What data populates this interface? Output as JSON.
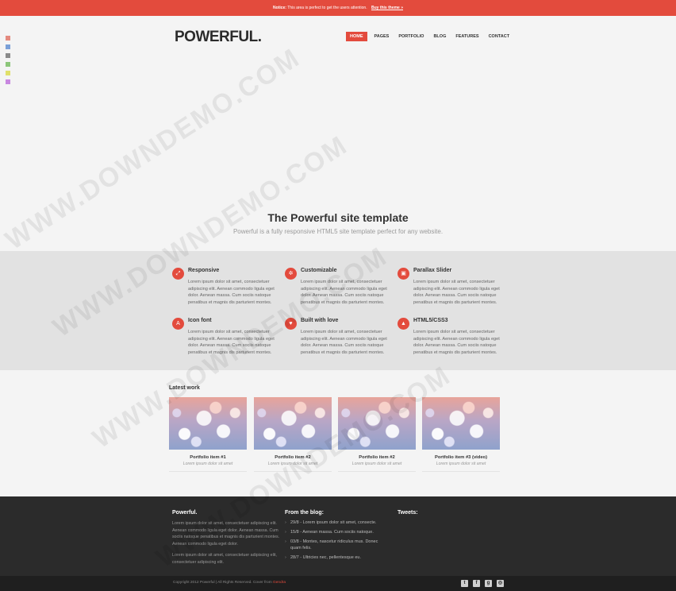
{
  "notice": {
    "label": "Notice:",
    "text": "This area is perfect to get the users attention.",
    "cta": "Buy this theme »"
  },
  "swatches": [
    "#e48a7f",
    "#7aa0d8",
    "#8a8a8a",
    "#8cc67a",
    "#e0e06a",
    "#c888e0"
  ],
  "logo": "POWERFUL.",
  "nav": {
    "items": [
      {
        "label": "HOME",
        "active": true
      },
      {
        "label": "PAGES"
      },
      {
        "label": "PORTFOLIO"
      },
      {
        "label": "BLOG"
      },
      {
        "label": "FEATURES"
      },
      {
        "label": "CONTACT"
      }
    ]
  },
  "hero": {
    "title": "The Powerful site template",
    "subtitle": "Powerful is a fully responsive HTML5 site template perfect for any website."
  },
  "features": [
    {
      "title": "Responsive",
      "icon": "arrows-icon",
      "text": "Lorem ipsum dolor sit amet, consectetuer adipiscing elit. Aenean commodo ligula eget dolor. Aenean massa. Cum sociis natoque penatibus et magnis dis parturient montes."
    },
    {
      "title": "Customizable",
      "icon": "gears-icon",
      "text": "Lorem ipsum dolor sit amet, consectetuer adipiscing elit. Aenean commodo ligula eget dolor. Aenean massa. Cum sociis natoque penatibus et magnis dis parturient montes."
    },
    {
      "title": "Parallax Slider",
      "icon": "image-icon",
      "text": "Lorem ipsum dolor sit amet, consectetuer adipiscing elit. Aenean commodo ligula eget dolor. Aenean massa. Cum sociis natoque penatibus et magnis dis parturient montes."
    },
    {
      "title": "Icon font",
      "icon": "font-icon",
      "text": "Lorem ipsum dolor sit amet, consectetuer adipiscing elit. Aenean commodo ligula eget dolor. Aenean massa. Cum sociis natoque penatibus et magnis dis parturient montes."
    },
    {
      "title": "Built with love",
      "icon": "heart-icon",
      "text": "Lorem ipsum dolor sit amet, consectetuer adipiscing elit. Aenean commodo ligula eget dolor. Aenean massa. Cum sociis natoque penatibus et magnis dis parturient montes."
    },
    {
      "title": "HTML5/CSS3",
      "icon": "html5-icon",
      "text": "Lorem ipsum dolor sit amet, consectetuer adipiscing elit. Aenean commodo ligula eget dolor. Aenean massa. Cum sociis natoque penatibus et magnis dis parturient montes."
    }
  ],
  "latest": {
    "title": "Latest work",
    "items": [
      {
        "title": "Portfolio item #1",
        "subtitle": "Lorem ipsum dolor sit amet"
      },
      {
        "title": "Portfolio item #2",
        "subtitle": "Lorem ipsum dolor sit amet"
      },
      {
        "title": "Portfolio item #2",
        "subtitle": "Lorem ipsum dolor sit amet"
      },
      {
        "title": "Portfolio item #3 (video)",
        "subtitle": "Lorem ipsum dolor sit amet"
      }
    ]
  },
  "footer": {
    "about": {
      "title": "Powerful.",
      "p1": "Lorem ipsum dolor sit amet, consectetuer adipiscing elit. Aenean commodo ligula eget dolor. Aenean massa. Cum sociis natoque penatibus et magnis dis parturient montes. Aenean commodo ligula eget dolor.",
      "p2": "Lorem ipsum dolor sit amet, consectetuer adipiscing elit, consectetuer adipiscing elit."
    },
    "blog": {
      "title": "From the blog:",
      "items": [
        "29/8 - Lorem ipsum dolor sit amet, consecte.",
        "15/8 - Aenean massa. Cum sociis natoque.",
        "03/8 - Montes, nascetur ridiculus mus. Donec quam felis.",
        "28/7 - Ultricies nec, pellentesque eu."
      ]
    },
    "tweets": {
      "title": "Tweets:"
    }
  },
  "bottom": {
    "copyright": "Copyright 2012 Powerful | All Rights Reserved. Cover from",
    "link": "Gendra"
  },
  "watermark": "WWW.DOWNDEMO.COM"
}
